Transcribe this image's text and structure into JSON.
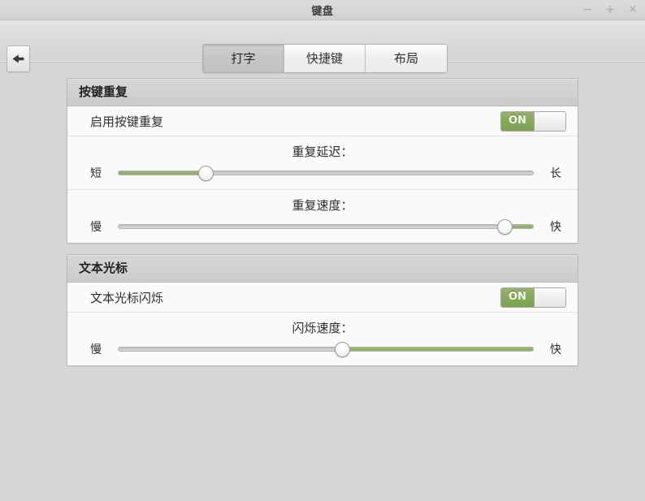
{
  "window": {
    "title": "键盘",
    "controls": {
      "minimize": "−",
      "maximize": "+",
      "close": "×"
    }
  },
  "toolbar": {
    "back_label": "back-arrow",
    "tabs": [
      {
        "label": "打字",
        "active": true
      },
      {
        "label": "快捷键",
        "active": false
      },
      {
        "label": "布局",
        "active": false
      }
    ]
  },
  "panels": [
    {
      "header": "按键重复",
      "toggle_row": {
        "label": "启用按键重复",
        "switch_state": "ON"
      },
      "sliders": [
        {
          "caption": "重复延迟：",
          "left_label": "短",
          "right_label": "长",
          "value_percent": 21,
          "fill_side": "left"
        },
        {
          "caption": "重复速度：",
          "left_label": "慢",
          "right_label": "快",
          "value_percent": 93,
          "fill_side": "right"
        }
      ]
    },
    {
      "header": "文本光标",
      "toggle_row": {
        "label": "文本光标闪烁",
        "switch_state": "ON"
      },
      "sliders": [
        {
          "caption": "闪烁速度：",
          "left_label": "慢",
          "right_label": "快",
          "value_percent": 54,
          "fill_side": "right"
        }
      ]
    }
  ],
  "colors": {
    "accent_green": "#8fae66",
    "window_background": "#d6d6d6",
    "panel_background": "#fafafa",
    "panel_header": "#d0d0d0"
  }
}
